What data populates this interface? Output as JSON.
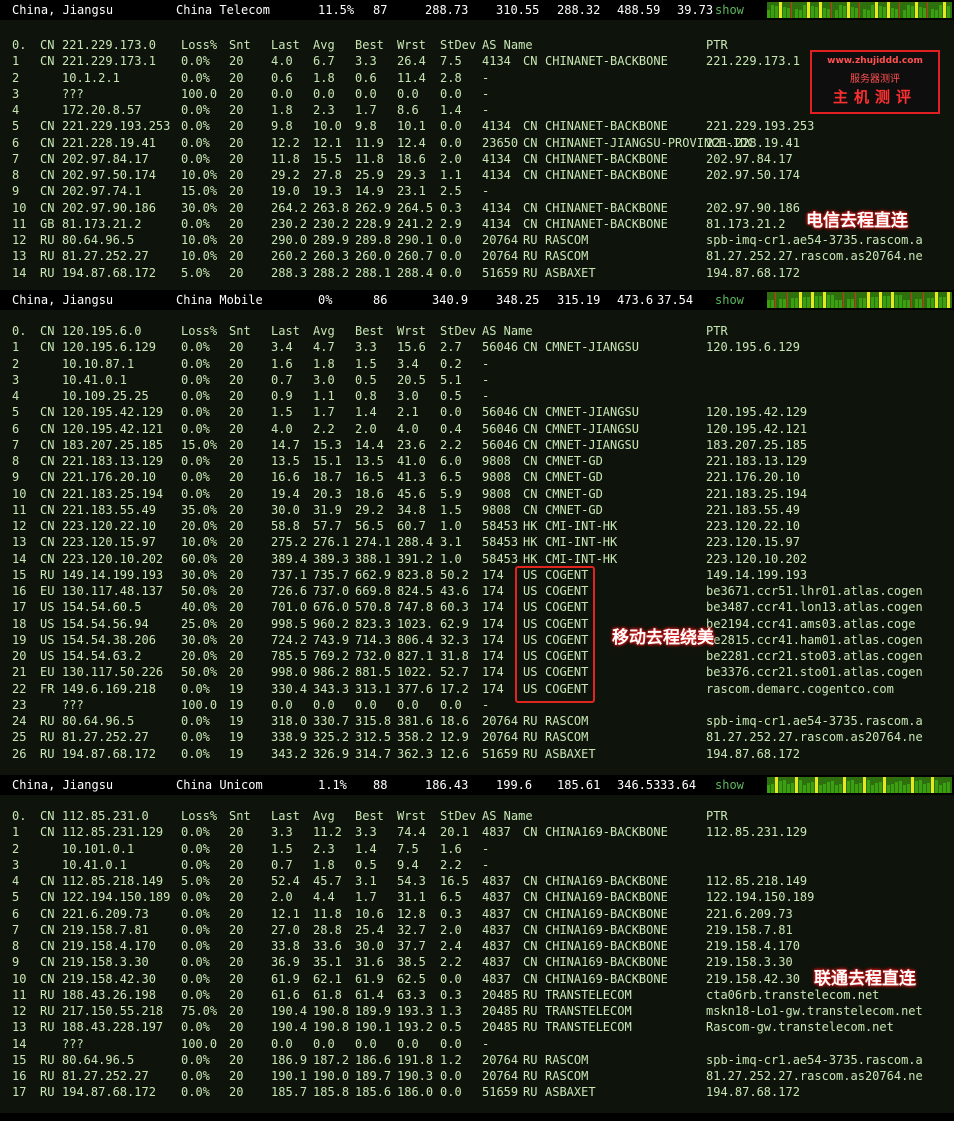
{
  "headers": [
    {
      "location": "China, Jiangsu",
      "isp": "China Telecom",
      "loss": "11.5%",
      "snt": "87",
      "last": "288.73",
      "avg": "310.55",
      "best": "288.32",
      "wrst": "488.59",
      "stdev": "39.73",
      "show": "show"
    },
    {
      "location": "China, Jiangsu",
      "isp": "China Mobile",
      "loss": "0%",
      "snt": "86",
      "last": "340.9",
      "avg": "348.25",
      "best": "315.19",
      "wrst": "473.6",
      "stdev": "37.54",
      "show": "show"
    },
    {
      "location": "China, Jiangsu",
      "isp": "China Unicom",
      "loss": "1.1%",
      "snt": "88",
      "last": "186.43",
      "avg": "199.6",
      "best": "185.61",
      "wrst": "346.53",
      "stdev": "33.64",
      "show": "show"
    }
  ],
  "columns": {
    "loss": "Loss%",
    "snt": "Snt",
    "last": "Last",
    "avg": "Avg",
    "best": "Best",
    "wrst": "Wrst",
    "stdev": "StDev",
    "as_name": "AS Name",
    "ptr": "PTR"
  },
  "telecom": [
    [
      "0.",
      "CN",
      "221.229.173.0",
      "",
      "",
      "",
      "",
      "",
      "",
      "",
      "",
      "",
      "",
      ""
    ],
    [
      "1",
      "CN",
      "221.229.173.1",
      "0.0%",
      "20",
      "4.0",
      "6.7",
      "3.3",
      "26.4",
      "7.5",
      "4134",
      "CN",
      "CHINANET-BACKBONE",
      "221.229.173.1"
    ],
    [
      "2",
      "",
      "10.1.2.1",
      "0.0%",
      "20",
      "0.6",
      "1.8",
      "0.6",
      "11.4",
      "2.8",
      "-",
      "",
      "",
      ""
    ],
    [
      "3",
      "",
      "???",
      "100.0",
      "20",
      "0.0",
      "0.0",
      "0.0",
      "0.0",
      "0.0",
      "-",
      "",
      "",
      ""
    ],
    [
      "4",
      "",
      "172.20.8.57",
      "0.0%",
      "20",
      "1.8",
      "2.3",
      "1.7",
      "8.6",
      "1.4",
      "-",
      "",
      "",
      ""
    ],
    [
      "5",
      "CN",
      "221.229.193.253",
      "0.0%",
      "20",
      "9.8",
      "10.0",
      "9.8",
      "10.1",
      "0.0",
      "4134",
      "CN",
      "CHINANET-BACKBONE",
      "221.229.193.253"
    ],
    [
      "6",
      "CN",
      "221.228.19.41",
      "0.0%",
      "20",
      "12.2",
      "12.1",
      "11.9",
      "12.4",
      "0.0",
      "23650",
      "CN",
      "CHINANET-JIANGSU-PROVINCE-IDC",
      "221.228.19.41"
    ],
    [
      "7",
      "CN",
      "202.97.84.17",
      "0.0%",
      "20",
      "11.8",
      "15.5",
      "11.8",
      "18.6",
      "2.0",
      "4134",
      "CN",
      "CHINANET-BACKBONE",
      "202.97.84.17"
    ],
    [
      "8",
      "CN",
      "202.97.50.174",
      "10.0%",
      "20",
      "29.2",
      "27.8",
      "25.9",
      "29.3",
      "1.1",
      "4134",
      "CN",
      "CHINANET-BACKBONE",
      "202.97.50.174"
    ],
    [
      "9",
      "CN",
      "202.97.74.1",
      "15.0%",
      "20",
      "19.0",
      "19.3",
      "14.9",
      "23.1",
      "2.5",
      "-",
      "",
      "",
      ""
    ],
    [
      "10",
      "CN",
      "202.97.90.186",
      "30.0%",
      "20",
      "264.2",
      "263.8",
      "262.9",
      "264.5",
      "0.3",
      "4134",
      "CN",
      "CHINANET-BACKBONE",
      "202.97.90.186"
    ],
    [
      "11",
      "GB",
      "81.173.21.2",
      "0.0%",
      "20",
      "230.2",
      "230.2",
      "228.9",
      "241.2",
      "2.9",
      "4134",
      "CN",
      "CHINANET-BACKBONE",
      "81.173.21.2"
    ],
    [
      "12",
      "RU",
      "80.64.96.5",
      "10.0%",
      "20",
      "290.0",
      "289.9",
      "289.8",
      "290.1",
      "0.0",
      "20764",
      "RU",
      "RASCOM",
      "spb-imq-cr1.ae54-3735.rascom.a"
    ],
    [
      "13",
      "RU",
      "81.27.252.27",
      "10.0%",
      "20",
      "260.2",
      "260.3",
      "260.0",
      "260.7",
      "0.0",
      "20764",
      "RU",
      "RASCOM",
      "81.27.252.27.rascom.as20764.ne"
    ],
    [
      "14",
      "RU",
      "194.87.68.172",
      "5.0%",
      "20",
      "288.3",
      "288.2",
      "288.1",
      "288.4",
      "0.0",
      "51659",
      "RU",
      "ASBAXET",
      "194.87.68.172"
    ]
  ],
  "mobile": [
    [
      "0.",
      "CN",
      "120.195.6.0",
      "",
      "",
      "",
      "",
      "",
      "",
      "",
      "",
      "",
      "",
      ""
    ],
    [
      "1",
      "CN",
      "120.195.6.129",
      "0.0%",
      "20",
      "3.4",
      "4.7",
      "3.3",
      "15.6",
      "2.7",
      "56046",
      "CN",
      "CMNET-JIANGSU",
      "120.195.6.129"
    ],
    [
      "2",
      "",
      "10.10.87.1",
      "0.0%",
      "20",
      "1.6",
      "1.8",
      "1.5",
      "3.4",
      "0.2",
      "-",
      "",
      "",
      ""
    ],
    [
      "3",
      "",
      "10.41.0.1",
      "0.0%",
      "20",
      "0.7",
      "3.0",
      "0.5",
      "20.5",
      "5.1",
      "-",
      "",
      "",
      ""
    ],
    [
      "4",
      "",
      "10.109.25.25",
      "0.0%",
      "20",
      "0.9",
      "1.1",
      "0.8",
      "3.0",
      "0.5",
      "-",
      "",
      "",
      ""
    ],
    [
      "5",
      "CN",
      "120.195.42.129",
      "0.0%",
      "20",
      "1.5",
      "1.7",
      "1.4",
      "2.1",
      "0.0",
      "56046",
      "CN",
      "CMNET-JIANGSU",
      "120.195.42.129"
    ],
    [
      "6",
      "CN",
      "120.195.42.121",
      "0.0%",
      "20",
      "4.0",
      "2.2",
      "2.0",
      "4.0",
      "0.4",
      "56046",
      "CN",
      "CMNET-JIANGSU",
      "120.195.42.121"
    ],
    [
      "7",
      "CN",
      "183.207.25.185",
      "15.0%",
      "20",
      "14.7",
      "15.3",
      "14.4",
      "23.6",
      "2.2",
      "56046",
      "CN",
      "CMNET-JIANGSU",
      "183.207.25.185"
    ],
    [
      "8",
      "CN",
      "221.183.13.129",
      "0.0%",
      "20",
      "13.5",
      "15.1",
      "13.5",
      "41.0",
      "6.0",
      "9808",
      "CN",
      "CMNET-GD",
      "221.183.13.129"
    ],
    [
      "9",
      "CN",
      "221.176.20.10",
      "0.0%",
      "20",
      "16.6",
      "18.7",
      "16.5",
      "41.3",
      "6.5",
      "9808",
      "CN",
      "CMNET-GD",
      "221.176.20.10"
    ],
    [
      "10",
      "CN",
      "221.183.25.194",
      "0.0%",
      "20",
      "19.4",
      "20.3",
      "18.6",
      "45.6",
      "5.9",
      "9808",
      "CN",
      "CMNET-GD",
      "221.183.25.194"
    ],
    [
      "11",
      "CN",
      "221.183.55.49",
      "35.0%",
      "20",
      "30.0",
      "31.9",
      "29.2",
      "34.8",
      "1.5",
      "9808",
      "CN",
      "CMNET-GD",
      "221.183.55.49"
    ],
    [
      "12",
      "CN",
      "223.120.22.10",
      "20.0%",
      "20",
      "58.8",
      "57.7",
      "56.5",
      "60.7",
      "1.0",
      "58453",
      "HK",
      "CMI-INT-HK",
      "223.120.22.10"
    ],
    [
      "13",
      "CN",
      "223.120.15.97",
      "10.0%",
      "20",
      "275.2",
      "276.1",
      "274.1",
      "288.4",
      "3.1",
      "58453",
      "HK",
      "CMI-INT-HK",
      "223.120.15.97"
    ],
    [
      "14",
      "CN",
      "223.120.10.202",
      "60.0%",
      "20",
      "389.4",
      "389.3",
      "388.1",
      "391.2",
      "1.0",
      "58453",
      "HK",
      "CMI-INT-HK",
      "223.120.10.202"
    ],
    [
      "15",
      "RU",
      "149.14.199.193",
      "30.0%",
      "20",
      "737.1",
      "735.7",
      "662.9",
      "823.8",
      "50.2",
      "174",
      "US",
      "COGENT",
      "149.14.199.193"
    ],
    [
      "16",
      "EU",
      "130.117.48.137",
      "50.0%",
      "20",
      "726.6",
      "737.0",
      "669.8",
      "824.5",
      "43.6",
      "174",
      "US",
      "COGENT",
      "be3671.ccr51.lhr01.atlas.cogen"
    ],
    [
      "17",
      "US",
      "154.54.60.5",
      "40.0%",
      "20",
      "701.0",
      "676.0",
      "570.8",
      "747.8",
      "60.3",
      "174",
      "US",
      "COGENT",
      "be3487.ccr41.lon13.atlas.cogen"
    ],
    [
      "18",
      "US",
      "154.54.56.94",
      "25.0%",
      "20",
      "998.5",
      "960.2",
      "823.3",
      "1023.",
      "62.9",
      "174",
      "US",
      "COGENT",
      "be2194.ccr41.ams03.atlas.coge"
    ],
    [
      "19",
      "US",
      "154.54.38.206",
      "30.0%",
      "20",
      "724.2",
      "743.9",
      "714.3",
      "806.4",
      "32.3",
      "174",
      "US",
      "COGENT",
      "be2815.ccr41.ham01.atlas.cogen"
    ],
    [
      "20",
      "US",
      "154.54.63.2",
      "20.0%",
      "20",
      "785.5",
      "769.2",
      "732.0",
      "827.1",
      "31.8",
      "174",
      "US",
      "COGENT",
      "be2281.ccr21.sto03.atlas.cogen"
    ],
    [
      "21",
      "EU",
      "130.117.50.226",
      "50.0%",
      "20",
      "998.0",
      "986.2",
      "881.5",
      "1022.",
      "52.7",
      "174",
      "US",
      "COGENT",
      "be3376.ccr21.sto01.atlas.cogen"
    ],
    [
      "22",
      "FR",
      "149.6.169.218",
      "0.0%",
      "19",
      "330.4",
      "343.3",
      "313.1",
      "377.6",
      "17.2",
      "174",
      "US",
      "COGENT",
      "rascom.demarc.cogentco.com"
    ],
    [
      "23",
      "",
      "???",
      "100.0",
      "19",
      "0.0",
      "0.0",
      "0.0",
      "0.0",
      "0.0",
      "-",
      "",
      "",
      ""
    ],
    [
      "24",
      "RU",
      "80.64.96.5",
      "0.0%",
      "19",
      "318.0",
      "330.7",
      "315.8",
      "381.6",
      "18.6",
      "20764",
      "RU",
      "RASCOM",
      "spb-imq-cr1.ae54-3735.rascom.a"
    ],
    [
      "25",
      "RU",
      "81.27.252.27",
      "0.0%",
      "19",
      "338.9",
      "325.2",
      "312.5",
      "358.2",
      "12.9",
      "20764",
      "RU",
      "RASCOM",
      "81.27.252.27.rascom.as20764.ne"
    ],
    [
      "26",
      "RU",
      "194.87.68.172",
      "0.0%",
      "19",
      "343.2",
      "326.9",
      "314.7",
      "362.3",
      "12.6",
      "51659",
      "RU",
      "ASBAXET",
      "194.87.68.172"
    ]
  ],
  "unicom": [
    [
      "0.",
      "CN",
      "112.85.231.0",
      "",
      "",
      "",
      "",
      "",
      "",
      "",
      "",
      "",
      "",
      ""
    ],
    [
      "1",
      "CN",
      "112.85.231.129",
      "0.0%",
      "20",
      "3.3",
      "11.2",
      "3.3",
      "74.4",
      "20.1",
      "4837",
      "CN",
      "CHINA169-BACKBONE",
      "112.85.231.129"
    ],
    [
      "2",
      "",
      "10.101.0.1",
      "0.0%",
      "20",
      "1.5",
      "2.3",
      "1.4",
      "7.5",
      "1.6",
      "-",
      "",
      "",
      ""
    ],
    [
      "3",
      "",
      "10.41.0.1",
      "0.0%",
      "20",
      "0.7",
      "1.8",
      "0.5",
      "9.4",
      "2.2",
      "-",
      "",
      "",
      ""
    ],
    [
      "4",
      "CN",
      "112.85.218.149",
      "5.0%",
      "20",
      "52.4",
      "45.7",
      "3.1",
      "54.3",
      "16.5",
      "4837",
      "CN",
      "CHINA169-BACKBONE",
      "112.85.218.149"
    ],
    [
      "5",
      "CN",
      "122.194.150.189",
      "0.0%",
      "20",
      "2.0",
      "4.4",
      "1.7",
      "31.1",
      "6.5",
      "4837",
      "CN",
      "CHINA169-BACKBONE",
      "122.194.150.189"
    ],
    [
      "6",
      "CN",
      "221.6.209.73",
      "0.0%",
      "20",
      "12.1",
      "11.8",
      "10.6",
      "12.8",
      "0.3",
      "4837",
      "CN",
      "CHINA169-BACKBONE",
      "221.6.209.73"
    ],
    [
      "7",
      "CN",
      "219.158.7.81",
      "0.0%",
      "20",
      "27.0",
      "28.8",
      "25.4",
      "32.7",
      "2.0",
      "4837",
      "CN",
      "CHINA169-BACKBONE",
      "219.158.7.81"
    ],
    [
      "8",
      "CN",
      "219.158.4.170",
      "0.0%",
      "20",
      "33.8",
      "33.6",
      "30.0",
      "37.7",
      "2.4",
      "4837",
      "CN",
      "CHINA169-BACKBONE",
      "219.158.4.170"
    ],
    [
      "9",
      "CN",
      "219.158.3.30",
      "0.0%",
      "20",
      "36.9",
      "35.1",
      "31.6",
      "38.5",
      "2.2",
      "4837",
      "CN",
      "CHINA169-BACKBONE",
      "219.158.3.30"
    ],
    [
      "10",
      "CN",
      "219.158.42.30",
      "0.0%",
      "20",
      "61.9",
      "62.1",
      "61.9",
      "62.5",
      "0.0",
      "4837",
      "CN",
      "CHINA169-BACKBONE",
      "219.158.42.30"
    ],
    [
      "11",
      "RU",
      "188.43.26.198",
      "0.0%",
      "20",
      "61.6",
      "61.8",
      "61.4",
      "63.3",
      "0.3",
      "20485",
      "RU",
      "TRANSTELECOM",
      "cta06rb.transtelecom.net"
    ],
    [
      "12",
      "RU",
      "217.150.55.218",
      "75.0%",
      "20",
      "190.4",
      "190.8",
      "189.9",
      "193.3",
      "1.3",
      "20485",
      "RU",
      "TRANSTELECOM",
      "mskn18-Lo1-gw.transtelecom.net"
    ],
    [
      "13",
      "RU",
      "188.43.228.197",
      "0.0%",
      "20",
      "190.4",
      "190.8",
      "190.1",
      "193.2",
      "0.5",
      "20485",
      "RU",
      "TRANSTELECOM",
      "Rascom-gw.transtelecom.net"
    ],
    [
      "14",
      "",
      "???",
      "100.0",
      "20",
      "0.0",
      "0.0",
      "0.0",
      "0.0",
      "0.0",
      "-",
      "",
      "",
      ""
    ],
    [
      "15",
      "RU",
      "80.64.96.5",
      "0.0%",
      "20",
      "186.9",
      "187.2",
      "186.6",
      "191.8",
      "1.2",
      "20764",
      "RU",
      "RASCOM",
      "spb-imq-cr1.ae54-3735.rascom.a"
    ],
    [
      "16",
      "RU",
      "81.27.252.27",
      "0.0%",
      "20",
      "190.1",
      "190.0",
      "189.7",
      "190.3",
      "0.0",
      "20764",
      "RU",
      "RASCOM",
      "81.27.252.27.rascom.as20764.ne"
    ],
    [
      "17",
      "RU",
      "194.87.68.172",
      "0.0%",
      "20",
      "185.7",
      "185.8",
      "185.6",
      "186.0",
      "0.0",
      "51659",
      "RU",
      "ASBAXET",
      "194.87.68.172"
    ]
  ],
  "annotations": {
    "telecom": "电信去程直连",
    "mobile": "移动去程绕美",
    "unicom": "联通去程直连"
  },
  "logo": {
    "url": "www.zhujiddd.com",
    "sub": "服务器测评",
    "main": "主机测评"
  },
  "colors": {
    "text": "#c8e6b4",
    "header_bg": "#000000",
    "panel_bg": "#0e140c",
    "page_bg": "#1f1f1f",
    "show_link": "#5cb85c",
    "highlight": "#e0251f",
    "spark_green": "#2e6f0e"
  }
}
